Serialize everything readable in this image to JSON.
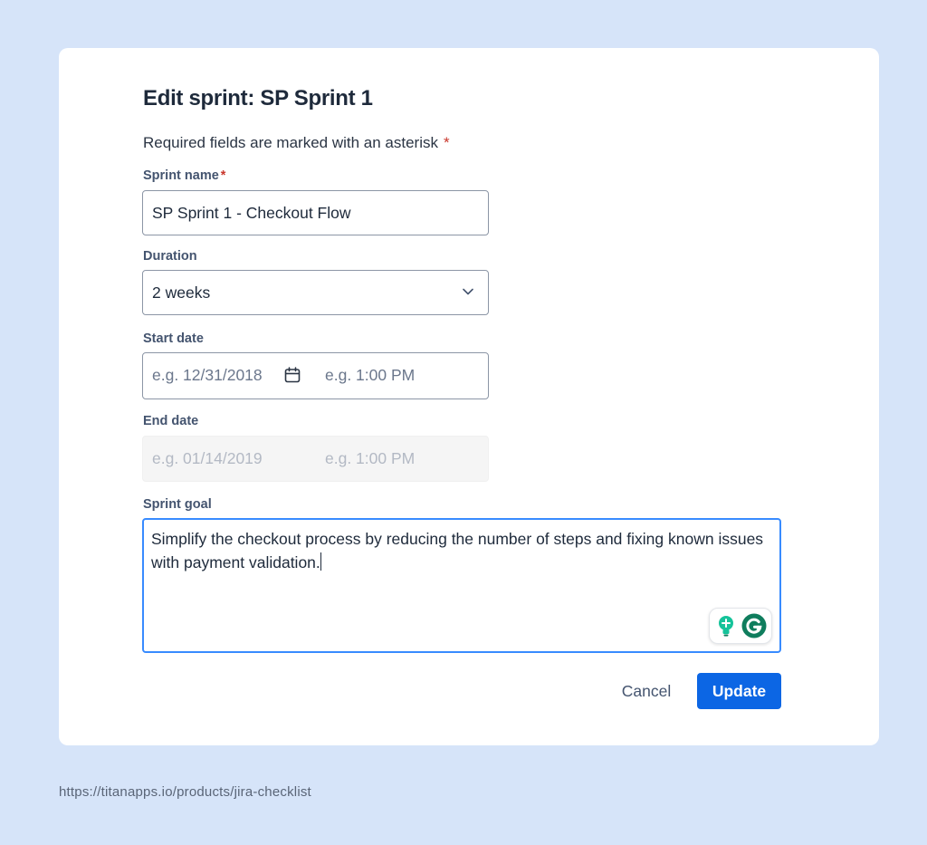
{
  "dialog": {
    "title": "Edit sprint: SP Sprint 1",
    "required_note": "Required fields are marked with an asterisk",
    "asterisk": "*"
  },
  "fields": {
    "sprint_name": {
      "label": "Sprint name",
      "value": "SP Sprint 1 - Checkout Flow"
    },
    "duration": {
      "label": "Duration",
      "value": "2 weeks"
    },
    "start_date": {
      "label": "Start date",
      "date_placeholder": "e.g. 12/31/2018",
      "time_placeholder": "e.g. 1:00 PM"
    },
    "end_date": {
      "label": "End date",
      "date_placeholder": "e.g. 01/14/2019",
      "time_placeholder": "e.g. 1:00 PM"
    },
    "sprint_goal": {
      "label": "Sprint goal",
      "value": "Simplify the checkout process by reducing the number of steps and fixing known issues with payment validation."
    }
  },
  "buttons": {
    "cancel": "Cancel",
    "update": "Update"
  },
  "footer": {
    "url": "https://titanapps.io/products/jira-checklist"
  },
  "icons": {
    "duration_dropdown": "chevron-down-icon",
    "start_date_picker": "calendar-icon",
    "grammarly_suggestions": "lightbulb-icon",
    "grammarly_logo": "grammarly-g-icon"
  },
  "colors": {
    "background": "#d6e4f9",
    "primary": "#0c66e4",
    "focus_border": "#388bff",
    "required_asterisk": "#c9372c",
    "grammarly_green": "#15c39a",
    "grammarly_dark": "#0f7d5d"
  }
}
